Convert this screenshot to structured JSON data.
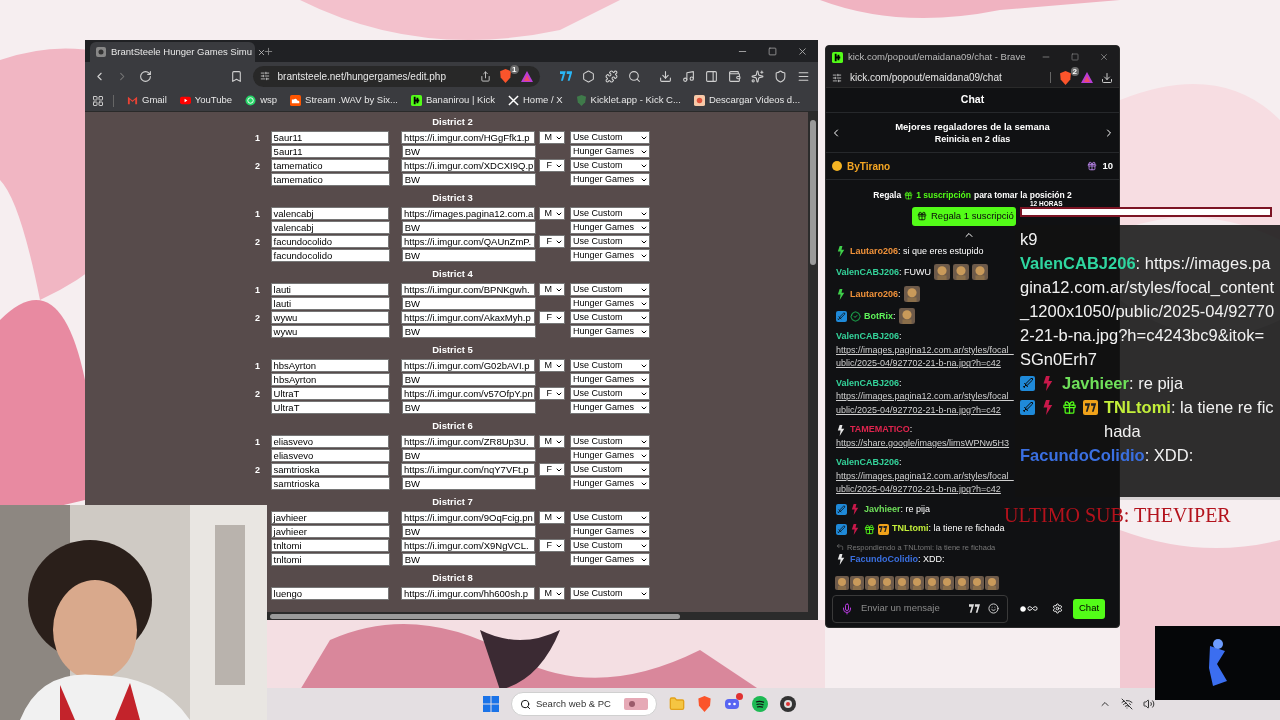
{
  "browser": {
    "tab_title": "BrantSteele Hunger Games Simu",
    "url": "brantsteele.net/hungergames/edit.php",
    "shield_count": "1",
    "bookmarks": [
      {
        "label": "Gmail",
        "kind": "gmail"
      },
      {
        "label": "YouTube",
        "kind": "youtube"
      },
      {
        "label": "wsp",
        "kind": "whatsapp"
      },
      {
        "label": "Stream .WAV by Six...",
        "kind": "soundcloud"
      },
      {
        "label": "Bananirou | Kick",
        "kind": "kick"
      },
      {
        "label": "Home / X",
        "kind": "x"
      },
      {
        "label": "Kicklet.app - Kick C...",
        "kind": "kicklet"
      },
      {
        "label": "Descargar Videos d...",
        "kind": "download"
      }
    ]
  },
  "districts": [
    {
      "title": "District 2",
      "rows": [
        {
          "number": "1",
          "name": "5aur11",
          "image": "https://i.imgur.com/HGgFfk1.p",
          "gender": "M",
          "mode": "Use Custom"
        },
        {
          "name": "5aur11",
          "image": "BW",
          "mode": "Hunger Games"
        },
        {
          "number": "2",
          "name": "tamematico",
          "image": "https://i.imgur.com/XDCXI9Q.p",
          "gender": "F",
          "mode": "Use Custom"
        },
        {
          "name": "tamematico",
          "image": "BW",
          "mode": "Hunger Games"
        }
      ]
    },
    {
      "title": "District 3",
      "rows": [
        {
          "number": "1",
          "name": "valencabj",
          "image": "https://images.pagina12.com.a",
          "gender": "M",
          "mode": "Use Custom"
        },
        {
          "name": "valencabj",
          "image": "BW",
          "mode": "Hunger Games"
        },
        {
          "number": "2",
          "name": "facundocolido",
          "image": "https://i.imgur.com/QAUnZmP.",
          "gender": "F",
          "mode": "Use Custom"
        },
        {
          "name": "facundocolido",
          "image": "BW",
          "mode": "Hunger Games"
        }
      ]
    },
    {
      "title": "District 4",
      "rows": [
        {
          "number": "1",
          "name": "lauti",
          "image": "https://i.imgur.com/BPNKgwh.",
          "gender": "M",
          "mode": "Use Custom"
        },
        {
          "name": "lauti",
          "image": "BW",
          "mode": "Hunger Games"
        },
        {
          "number": "2",
          "name": "wywu",
          "image": "https://i.imgur.com/AkaxMyh.p",
          "gender": "F",
          "mode": "Use Custom"
        },
        {
          "name": "wywu",
          "image": "BW",
          "mode": "Hunger Games"
        }
      ]
    },
    {
      "title": "District 5",
      "rows": [
        {
          "number": "1",
          "name": "hbsAyrton",
          "image": "https://i.imgur.com/G02bAVI.p",
          "gender": "M",
          "mode": "Use Custom"
        },
        {
          "name": "hbsAyrton",
          "image": "BW",
          "mode": "Hunger Games"
        },
        {
          "number": "2",
          "name": "UltraT",
          "image": "https://i.imgur.com/v57OfpY.pn",
          "gender": "F",
          "mode": "Use Custom"
        },
        {
          "name": "UltraT",
          "image": "BW",
          "mode": "Hunger Games"
        }
      ]
    },
    {
      "title": "District 6",
      "rows": [
        {
          "number": "1",
          "name": "eliasvevo",
          "image": "https://i.imgur.com/ZR8Up3U.",
          "gender": "M",
          "mode": "Use Custom"
        },
        {
          "name": "eliasvevo",
          "image": "BW",
          "mode": "Hunger Games"
        },
        {
          "number": "2",
          "name": "samtrioska",
          "image": "https://i.imgur.com/nqY7VFt.p",
          "gender": "F",
          "mode": "Use Custom"
        },
        {
          "name": "samtrioska",
          "image": "BW",
          "mode": "Hunger Games"
        }
      ]
    },
    {
      "title": "District 7",
      "rows": [
        {
          "name": "javhieer",
          "image": "https://i.imgur.com/9OqFcig.pn",
          "gender": "M",
          "mode": "Use Custom"
        },
        {
          "name": "javhieer",
          "image": "BW",
          "mode": "Hunger Games"
        },
        {
          "name": "tnltomi",
          "image": "https://i.imgur.com/X9NgVCL.",
          "gender": "F",
          "mode": "Use Custom"
        },
        {
          "name": "tnltomi",
          "image": "BW",
          "mode": "Hunger Games"
        }
      ]
    },
    {
      "title": "District 8",
      "rows": [
        {
          "name": "luengo",
          "image": "https://i.imgur.com/hh600sh.p",
          "gender": "M",
          "mode": "Use Custom"
        }
      ]
    }
  ],
  "chat_window": {
    "title": "kick.com/popout/emaidana09/chat - Brave",
    "url": "kick.com/popout/emaidana09/chat",
    "shield_count": "2",
    "header": "Chat",
    "leaderboard_title": "Mejores regaladores de la semana",
    "leaderboard_subtitle": "Reinicia en 2 días",
    "top_gifter": {
      "name": "ByTirano",
      "count": "10"
    },
    "gift_prompt_before": "Regala",
    "gift_prompt_highlight": "1 suscripción",
    "gift_prompt_after": "para tomar la posición 2",
    "gift_button": "Regala 1 suscripció",
    "messages": [
      {
        "badges": [
          {
            "kind": "sub",
            "color": "#3fd04a"
          }
        ],
        "user": "Lautaro206",
        "color": "#f0923a",
        "text": ": si que eres estupido"
      },
      {
        "user": "ValenCABJ206",
        "color": "#34d39a",
        "text": ": FUWU",
        "emotes": [
          {
            "kind": "picture"
          },
          {
            "kind": "picture"
          },
          {
            "kind": "picture"
          }
        ]
      },
      {
        "badges": [
          {
            "kind": "sub",
            "color": "#3fd04a"
          }
        ],
        "user": "Lautaro206",
        "color": "#f0923a",
        "text": ":",
        "emotes": [
          {
            "kind": "picture"
          }
        ]
      },
      {
        "badges": [
          {
            "kind": "moderator"
          },
          {
            "kind": "verified"
          }
        ],
        "user": "BotRix",
        "color": "#5ff25a",
        "text": ":",
        "emotes": [
          {
            "kind": "picture"
          }
        ]
      },
      {
        "user": "ValenCABJ206",
        "color": "#34d39a",
        "text": ":",
        "link_lines": [
          "https://images.pagina12.com.ar/styles/focal_",
          "ublic/2025-04/927702-21-b-na.jpg?h=c42"
        ]
      },
      {
        "user": "ValenCABJ206",
        "color": "#34d39a",
        "text": ":",
        "link_lines": [
          "https://images.pagina12.com.ar/styles/focal_",
          "ublic/2025-04/927702-21-b-na.jpg?h=c42"
        ]
      },
      {
        "badges": [
          {
            "kind": "sub",
            "color": "#e6e6e6"
          }
        ],
        "user": "TAMEMATICO",
        "color": "#e0244e",
        "text": ":",
        "link_lines": [
          "https://share.google/images/limsWPNw5H3"
        ]
      },
      {
        "user": "ValenCABJ206",
        "color": "#34d39a",
        "text": ":",
        "link_lines": [
          "https://images.pagina12.com.ar/styles/focal_",
          "ublic/2025-04/927702-21-b-na.jpg?h=c42"
        ]
      },
      {
        "badges": [
          {
            "kind": "moderator"
          },
          {
            "kind": "sub",
            "color": "#c8184a"
          }
        ],
        "user": "Javhieer",
        "color": "#6fe05a",
        "text": ": re pija"
      },
      {
        "badges": [
          {
            "kind": "moderator"
          },
          {
            "kind": "sub",
            "color": "#c8184a"
          },
          {
            "kind": "gift"
          },
          {
            "kind": "seventv"
          }
        ],
        "user": "TNLtomi",
        "color": "#c3ef3a",
        "text": ": la tiene re fichada"
      },
      {
        "reply": "Respondiendo a TNLtomi: la tiene re fichada",
        "badges": [
          {
            "kind": "sub",
            "color": "#e6e6e6"
          }
        ],
        "user": "FacundoColidio",
        "color": "#3a6fe0",
        "text": ": XDD:"
      }
    ],
    "emotes": [
      {
        "kind": "picture"
      },
      {
        "kind": "picture"
      },
      {
        "kind": "picture"
      },
      {
        "kind": "picture"
      },
      {
        "kind": "picture"
      },
      {
        "kind": "picture"
      },
      {
        "kind": "picture"
      },
      {
        "kind": "picture"
      },
      {
        "kind": "picture"
      },
      {
        "kind": "picture"
      },
      {
        "kind": "picture"
      }
    ],
    "input_placeholder": "Enviar un mensaje",
    "send_button": "Chat"
  },
  "stream_overlay": {
    "timer_label": "12 HORAS",
    "lines": [
      {
        "text": "k9"
      },
      {
        "user": "ValenCABJ206",
        "color": "#2fd6a0",
        "text": ": https://images.pagina12.com.ar/styles/focal_content_1200x1050/public/2025-04/927702-21-b-na.jpg?h=c4243bc9&itok=SGn0Erh7"
      },
      {
        "badges": [
          {
            "kind": "moderator"
          },
          {
            "kind": "sub",
            "color": "#c8184a"
          }
        ],
        "user": "Javhieer",
        "color": "#6fe05a",
        "text": ": re pija"
      },
      {
        "badges": [
          {
            "kind": "moderator"
          },
          {
            "kind": "sub",
            "color": "#c8184a"
          },
          {
            "kind": "gift"
          },
          {
            "kind": "seventv"
          }
        ],
        "user": "TNLtomi",
        "color": "#c3ef3a",
        "text": ": la tiene re fichada"
      },
      {
        "user": "FacundoColidio",
        "color": "#3a6fe0",
        "text": ": XDD:"
      }
    ],
    "last_sub": "ULTIMO SUB: THEVIPER"
  },
  "taskbar": {
    "search_placeholder": "Search web & PC"
  }
}
